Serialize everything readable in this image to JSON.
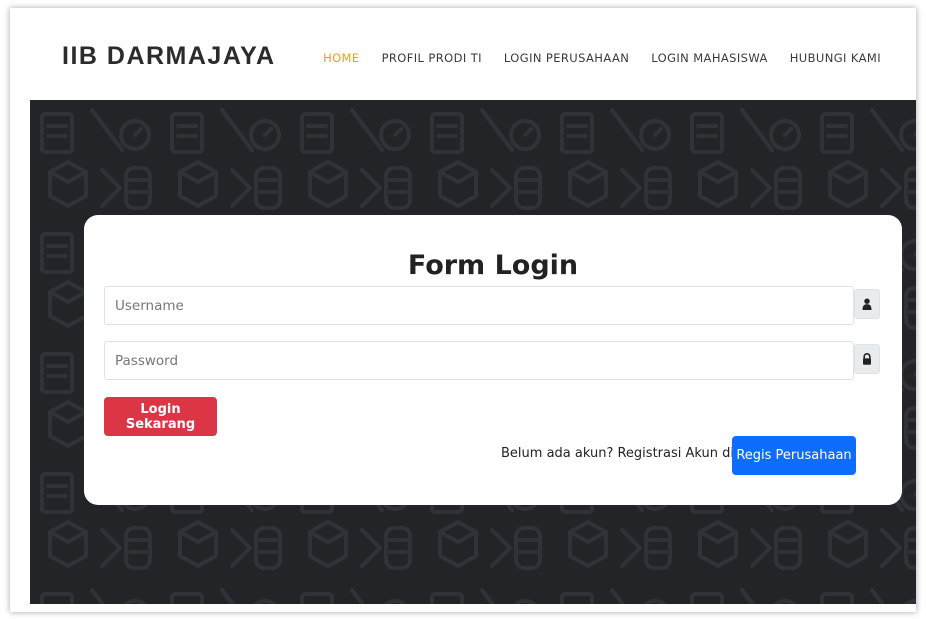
{
  "header": {
    "brand": "IIB DARMAJAYA",
    "nav": [
      {
        "label": "HOME",
        "active": true
      },
      {
        "label": "PROFIL PRODI TI",
        "active": false
      },
      {
        "label": "LOGIN PERUSAHAAN",
        "active": false
      },
      {
        "label": "LOGIN MAHASISWA",
        "active": false
      },
      {
        "label": "HUBUNGI KAMI",
        "active": false
      }
    ]
  },
  "form": {
    "title": "Form Login",
    "username": {
      "placeholder": "Username",
      "value": "",
      "icon": "user-icon"
    },
    "password": {
      "placeholder": "Password",
      "value": "",
      "icon": "lock-icon"
    },
    "login_button": "Login Sekarang",
    "register_prompt": "Belum ada akun? Registrasi Akun disini",
    "register_button": "Regis Perusahaan"
  },
  "colors": {
    "hero_background": "#222427",
    "nav_active": "#e4a11b",
    "login_button": "#dc3545",
    "register_button": "#0d6efd"
  }
}
